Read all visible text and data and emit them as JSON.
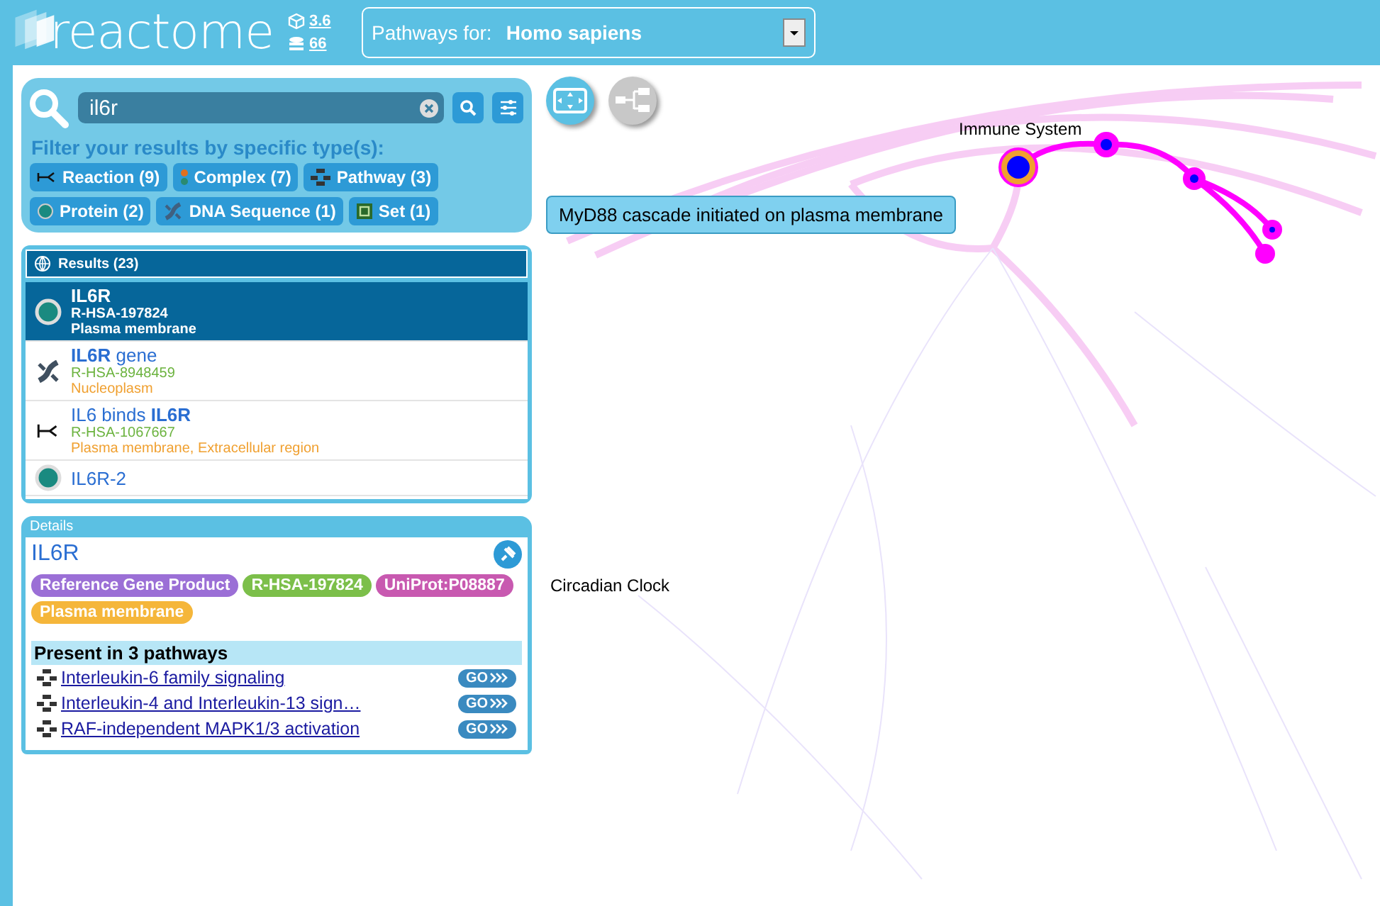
{
  "header": {
    "logo": "reactome",
    "versions": [
      {
        "kind": "release",
        "text": "3.6"
      },
      {
        "kind": "database",
        "text": "66"
      }
    ],
    "species": {
      "label": "Pathways for:",
      "value": "Homo sapiens"
    }
  },
  "search": {
    "query": "il6r",
    "filter_heading": "Filter your results by specific type(s):",
    "filters": [
      {
        "kind": "reaction",
        "label": "Reaction (9)"
      },
      {
        "kind": "complex",
        "label": "Complex (7)"
      },
      {
        "kind": "pathway",
        "label": "Pathway (3)"
      },
      {
        "kind": "protein",
        "label": "Protein (2)"
      },
      {
        "kind": "dna",
        "label": "DNA Sequence (1)"
      },
      {
        "kind": "set",
        "label": "Set (1)"
      }
    ]
  },
  "tooltip": "MyD88 cascade initiated on plasma membrane",
  "results": {
    "title": "Results (23)",
    "items": [
      {
        "kind": "protein",
        "selected": true,
        "name": "**IL6R**",
        "id": "R-HSA-197824",
        "location": "Plasma membrane"
      },
      {
        "kind": "dna",
        "selected": false,
        "name": "**IL6R** gene",
        "id": "R-HSA-8948459",
        "location": "Nucleoplasm"
      },
      {
        "kind": "reaction",
        "selected": false,
        "name": "IL6 binds **IL6R**",
        "id": "R-HSA-1067667",
        "location": "Plasma membrane, Extracellular region"
      },
      {
        "kind": "protein",
        "selected": false,
        "name": "IL6R-2"
      }
    ]
  },
  "details": {
    "heading": "Details",
    "title": "IL6R",
    "tags": [
      {
        "text": "Reference Gene Product",
        "color": "#9b6fd6"
      },
      {
        "text": "R-HSA-197824",
        "color": "#7cbf4a"
      },
      {
        "text": "UniProt:P08887",
        "color": "#c859b0"
      },
      {
        "text": "Plasma membrane",
        "color": "#f5b63a"
      }
    ],
    "pathways_heading": "Present in 3 pathways",
    "pathways": [
      {
        "name": "Interleukin-6 family signaling",
        "go": "GO"
      },
      {
        "name": "Interleukin-4 and Interleukin-13 sign…",
        "go": "GO"
      },
      {
        "name": "RAF-independent MAPK1/3 activation",
        "go": "GO"
      }
    ]
  },
  "canvas": {
    "labels": [
      {
        "text": "Immune System"
      },
      {
        "text": "Circadian Clock"
      }
    ]
  }
}
